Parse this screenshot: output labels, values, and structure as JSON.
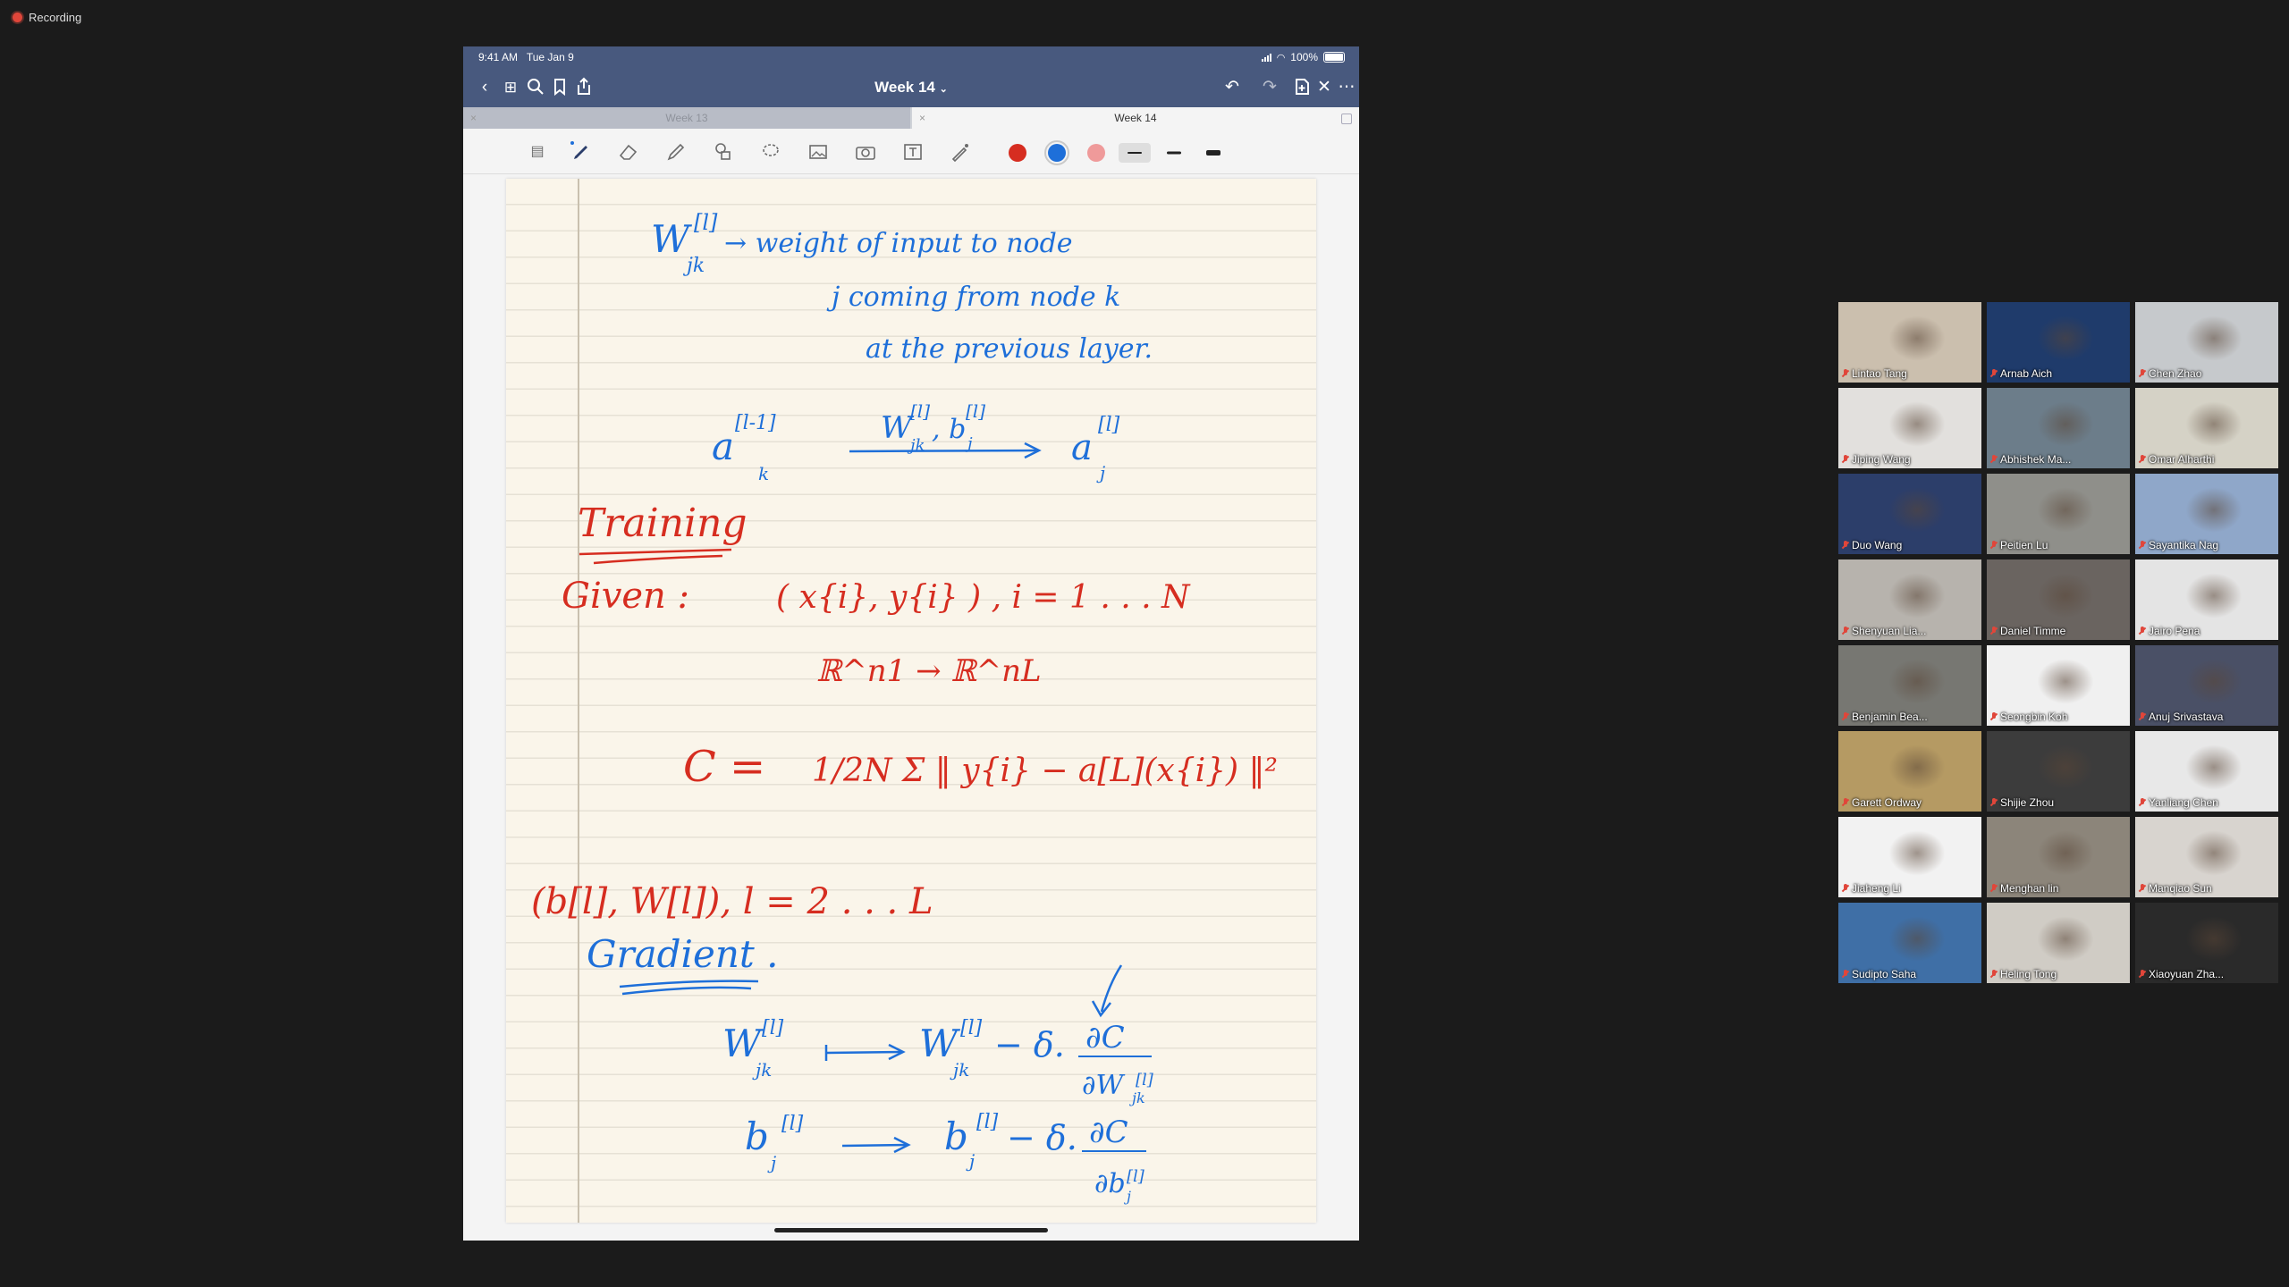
{
  "recording": {
    "label": "Recording"
  },
  "ipad": {
    "status_bar": {
      "time": "9:41 AM",
      "date": "Tue Jan 9",
      "battery": "100%"
    },
    "nav": {
      "title": "Week 14",
      "icons": [
        "back-chevron",
        "grid",
        "search",
        "bookmark",
        "share",
        "undo",
        "redo",
        "add-page",
        "close",
        "more"
      ]
    },
    "tabs": [
      {
        "label": "Week 13",
        "active": false
      },
      {
        "label": "Week 14",
        "active": true
      }
    ],
    "toolbar": {
      "tools": [
        "page-view",
        "pen",
        "eraser",
        "highlighter",
        "shapes",
        "lasso",
        "image",
        "camera",
        "text",
        "laser-pointer"
      ],
      "colors": [
        "#d62d20",
        "#1e6fd9",
        "#ef9a9a"
      ],
      "selected_color": "#1e6fd9",
      "stroke_widths": [
        "thin",
        "medium",
        "thick"
      ]
    },
    "notes": {
      "def_line1": "→ weight of input to node",
      "def_line2": "j coming from node k",
      "def_line3": "at the previous layer.",
      "heading_training": "Training",
      "given": "Given :",
      "data_pair": "( x{i}, y{i} ) , i = 1 . . . N",
      "spaces": "ℝ^n1 → ℝ^nL",
      "cost_lhs": "C =",
      "cost_rhs": "1/2N Σ ‖ y{i} − a[L](x{i}) ‖²",
      "params": "(b[l], W[l]),   l = 2 . . . L",
      "heading_gradient": "Gradient ."
    }
  },
  "participants": [
    {
      "name": "Lintao Tang",
      "bg": "#cbbfae"
    },
    {
      "name": "Arnab Aich",
      "bg": "#1f3b6b"
    },
    {
      "name": "Chen Zhao",
      "bg": "#c6c9cc"
    },
    {
      "name": "Jiping Wang",
      "bg": "#e2e0dd"
    },
    {
      "name": "Abhishek Ma...",
      "bg": "#6c7d8a"
    },
    {
      "name": "Omar Alharthi",
      "bg": "#d5d2c6"
    },
    {
      "name": "Duo Wang",
      "bg": "#2c3e6a"
    },
    {
      "name": "Peitien Lu",
      "bg": "#8f8f8a"
    },
    {
      "name": "Sayantika Nag",
      "bg": "#8fa7c9"
    },
    {
      "name": "Shenyuan Lia...",
      "bg": "#b7b3ad"
    },
    {
      "name": "Daniel Timme",
      "bg": "#6a6460"
    },
    {
      "name": "Jairo Pena",
      "bg": "#e4e4e4"
    },
    {
      "name": "Benjamin Bea...",
      "bg": "#777772"
    },
    {
      "name": "Seongbin Koh",
      "bg": "#f0f0f0"
    },
    {
      "name": "Anuj Srivastava",
      "bg": "#4a5066",
      "active": true
    },
    {
      "name": "Garett Ordway",
      "bg": "#b59a63"
    },
    {
      "name": "Shijie Zhou",
      "bg": "#3c3c3c"
    },
    {
      "name": "Yanliang Chen",
      "bg": "#e8e8e8"
    },
    {
      "name": "Jiaheng Li",
      "bg": "#f2f2f2"
    },
    {
      "name": "Menghan lin",
      "bg": "#8c857a"
    },
    {
      "name": "Manqiao Sun",
      "bg": "#d8d4cf"
    },
    {
      "name": "Sudipto Saha",
      "bg": "#3f6fa6"
    },
    {
      "name": "Heling Tong",
      "bg": "#d0ccc5"
    },
    {
      "name": "Xiaoyuan Zha...",
      "bg": "#2a2a2a"
    }
  ]
}
